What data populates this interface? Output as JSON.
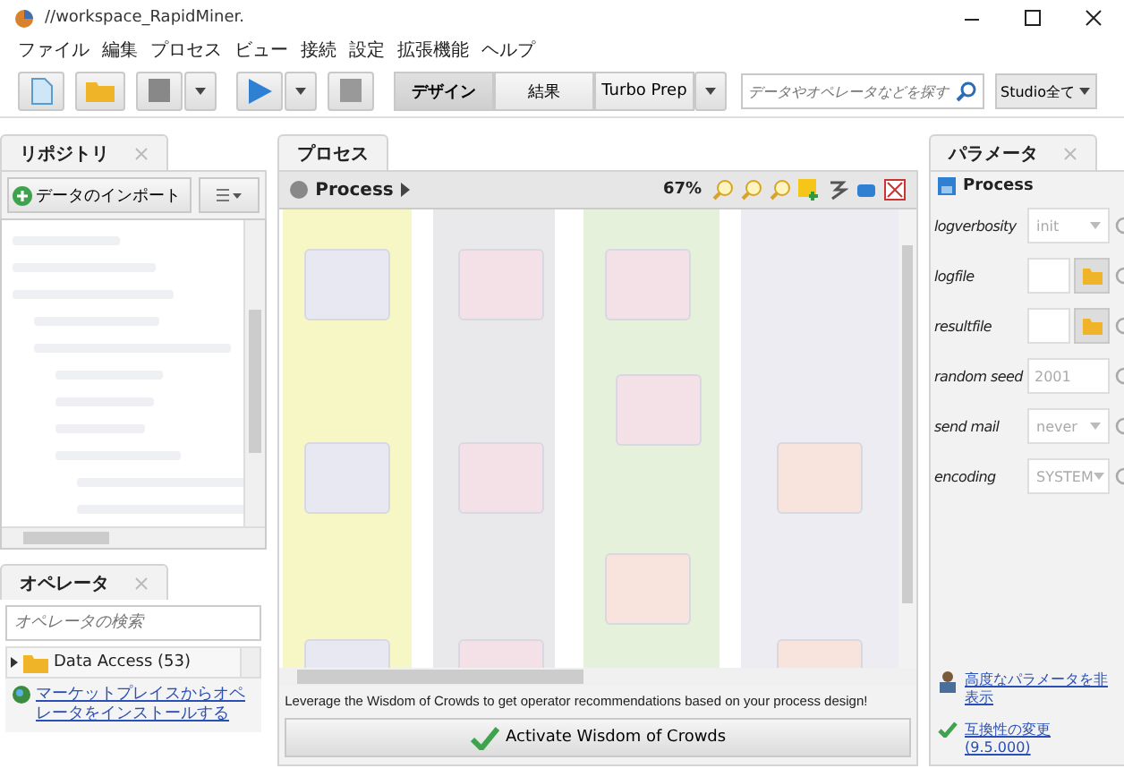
{
  "window": {
    "title": "//workspace_RapidMiner."
  },
  "menu": [
    "ファイル",
    "編集",
    "プロセス",
    "ビュー",
    "接続",
    "設定",
    "拡張機能",
    "ヘルプ"
  ],
  "toolbar": {
    "views": [
      {
        "label": "デザイン",
        "selected": true
      },
      {
        "label": "結果",
        "selected": false
      },
      {
        "label": "Turbo Prep",
        "selected": false
      }
    ],
    "search": {
      "placeholder": "データやオペレータなどを探す"
    },
    "scope": "Studio全て"
  },
  "repository": {
    "title": "リポジトリ",
    "import_button": "データのインポート"
  },
  "operators": {
    "title": "オペレータ",
    "search": {
      "placeholder": "オペレータの検索"
    },
    "items": [
      {
        "label": "Data Access (53)",
        "expanded": false
      }
    ],
    "marketplace_link": "マーケットプレイスからオペレータをインストールする"
  },
  "process": {
    "title": "プロセス",
    "breadcrumb": "Process",
    "zoom": "67%",
    "hint": "Leverage the Wisdom of Crowds to get operator recommendations based on your process design!",
    "button": "Activate Wisdom of Crowds"
  },
  "parameters": {
    "title": "パラメータ",
    "operator": "Process",
    "rows": [
      {
        "label": "logverbosity",
        "kind": "select",
        "value": "init"
      },
      {
        "label": "logfile",
        "kind": "file"
      },
      {
        "label": "resultfile",
        "kind": "file"
      },
      {
        "label": "random seed",
        "kind": "text",
        "value": "2001"
      },
      {
        "label": "send mail",
        "kind": "select",
        "value": "never"
      },
      {
        "label": "encoding",
        "kind": "select",
        "value": "SYSTEM"
      }
    ],
    "links": [
      {
        "label": "高度なパラメータを非表示",
        "kind": "user"
      },
      {
        "label": "互換性の変更 (9.5.000)",
        "kind": "check"
      }
    ]
  }
}
